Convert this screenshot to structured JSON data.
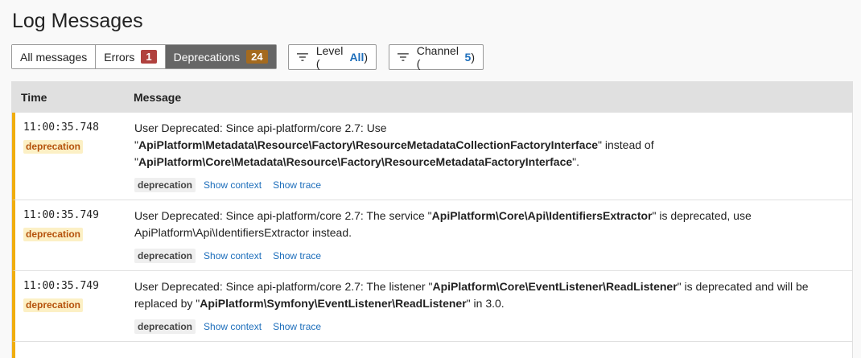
{
  "title": "Log Messages",
  "tabs": [
    {
      "label": "All messages"
    },
    {
      "label": "Errors",
      "count": "1",
      "badge_color": "#b0413e"
    },
    {
      "label": "Deprecations",
      "count": "24",
      "badge_color": "#a46a1f"
    }
  ],
  "filters": {
    "level": {
      "label": "Level (",
      "value": "All",
      "close": ")"
    },
    "channel": {
      "label": "Channel (",
      "value": "5",
      "close": ")"
    }
  },
  "table": {
    "headers": {
      "time": "Time",
      "message": "Message"
    },
    "rows": [
      {
        "time": "11:00:35.748",
        "level": "deprecation",
        "channel": "deprecation",
        "show_context": "Show context",
        "show_trace": "Show trace",
        "message_parts": [
          {
            "t": "User Deprecated: Since api-platform/core 2.7: Use \"",
            "b": false
          },
          {
            "t": "ApiPlatform\\Metadata\\Resource\\Factory\\ResourceMetadataCollectionFactoryInterface",
            "b": true
          },
          {
            "t": "\" instead of \"",
            "b": false
          },
          {
            "t": "ApiPlatform\\Core\\Metadata\\Resource\\Factory\\ResourceMetadataFactoryInterface",
            "b": true
          },
          {
            "t": "\".",
            "b": false
          }
        ]
      },
      {
        "time": "11:00:35.749",
        "level": "deprecation",
        "channel": "deprecation",
        "show_context": "Show context",
        "show_trace": "Show trace",
        "message_parts": [
          {
            "t": "User Deprecated: Since api-platform/core 2.7: The service \"",
            "b": false
          },
          {
            "t": "ApiPlatform\\Core\\Api\\IdentifiersExtractor",
            "b": true
          },
          {
            "t": "\" is deprecated, use ApiPlatform\\Api\\IdentifiersExtractor instead.",
            "b": false
          }
        ]
      },
      {
        "time": "11:00:35.749",
        "level": "deprecation",
        "channel": "deprecation",
        "show_context": "Show context",
        "show_trace": "Show trace",
        "message_parts": [
          {
            "t": "User Deprecated: Since api-platform/core 2.7: The listener \"",
            "b": false
          },
          {
            "t": "ApiPlatform\\Core\\EventListener\\ReadListener",
            "b": true
          },
          {
            "t": "\" is deprecated and will be replaced by \"",
            "b": false
          },
          {
            "t": "ApiPlatform\\Symfony\\EventListener\\ReadListener",
            "b": true
          },
          {
            "t": "\" in 3.0.",
            "b": false
          }
        ]
      }
    ]
  }
}
